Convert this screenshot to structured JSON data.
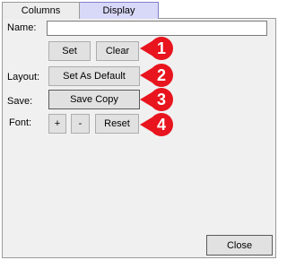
{
  "tabs": [
    {
      "label": "Columns"
    },
    {
      "label": "Display"
    }
  ],
  "form": {
    "name_label": "Name:",
    "name_value": "",
    "layout_label": "Layout:",
    "save_label": "Save:",
    "font_label": "Font:"
  },
  "buttons": {
    "set": "Set",
    "clear": "Clear",
    "set_default": "Set As Default",
    "save_copy": "Save Copy",
    "font_plus": "+",
    "font_minus": "-",
    "reset": "Reset",
    "close": "Close"
  },
  "markers": [
    "1",
    "2",
    "3",
    "4"
  ],
  "colors": {
    "marker": "#e8141e",
    "active_tab": "#d8d8f8",
    "panel": "#f0f0f0"
  }
}
